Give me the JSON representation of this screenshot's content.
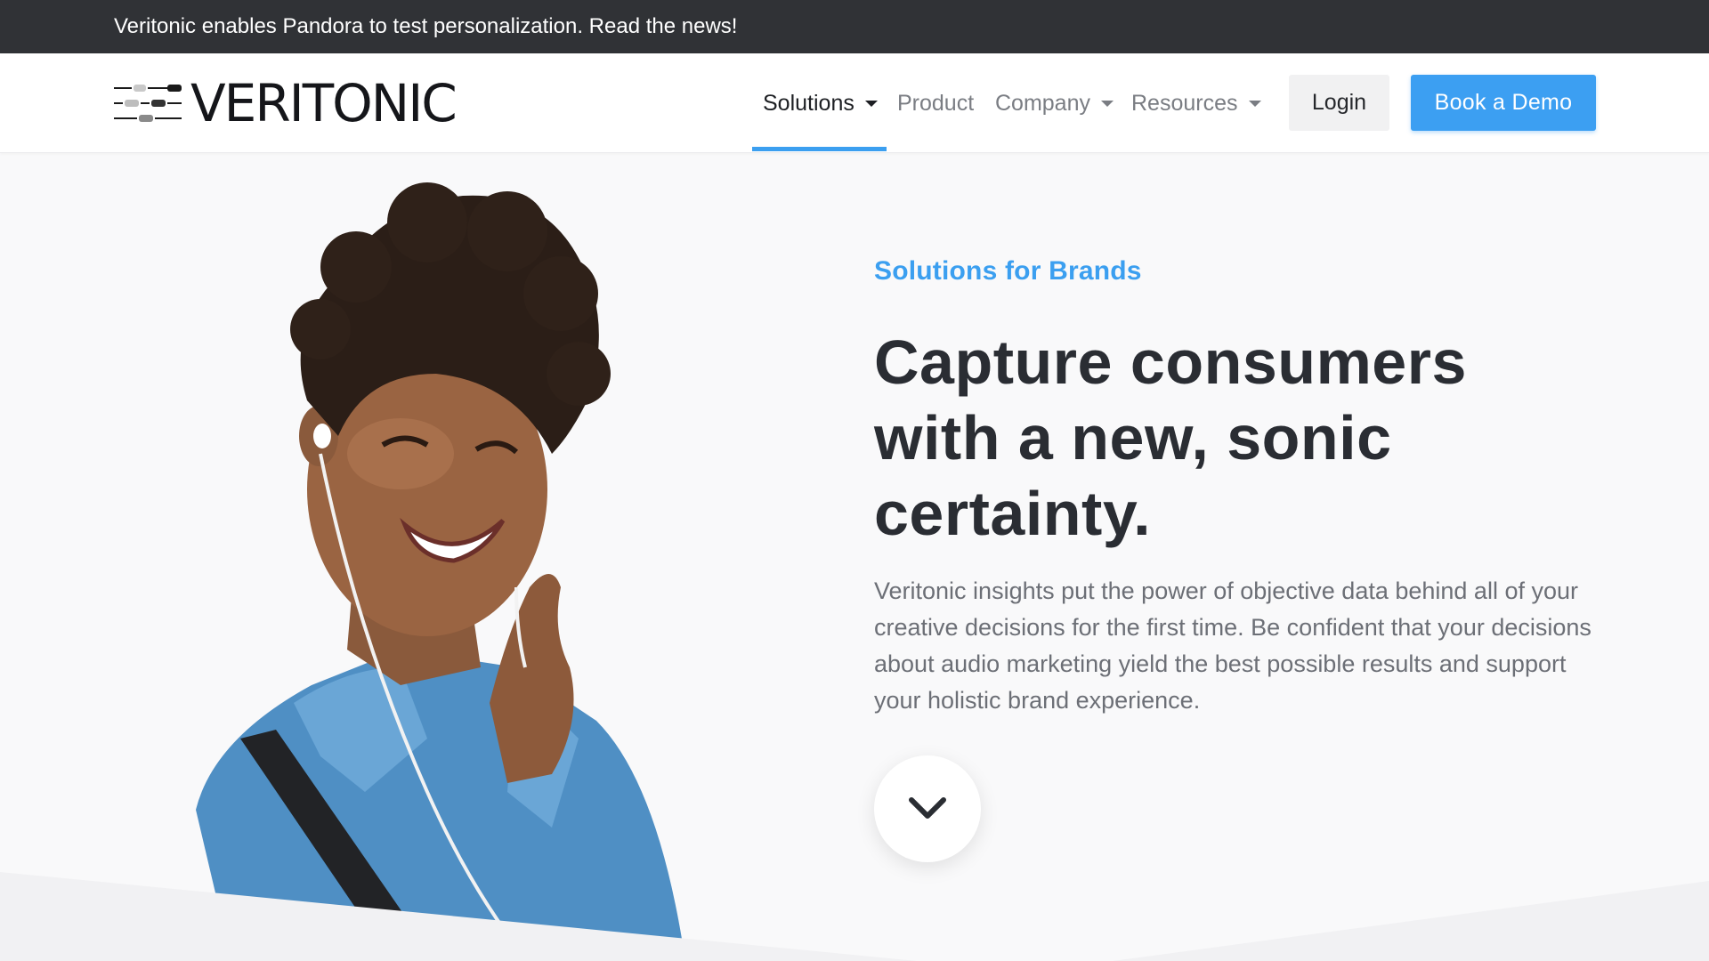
{
  "announcement": {
    "text": "Veritonic enables Pandora to test personalization. Read the news!"
  },
  "brand": {
    "name": "VERITONIC"
  },
  "nav": {
    "items": [
      {
        "label": "Solutions",
        "dropdown": true,
        "active": true
      },
      {
        "label": "Product",
        "dropdown": false,
        "active": false
      },
      {
        "label": "Company",
        "dropdown": true,
        "active": false
      },
      {
        "label": "Resources",
        "dropdown": true,
        "active": false
      }
    ],
    "login_label": "Login",
    "demo_label": "Book a Demo"
  },
  "hero": {
    "kicker": "Solutions for Brands",
    "headline": "Capture consumers with a new, sonic certainty.",
    "body": "Veritonic insights put the power of objective data behind all of your creative decisions for the first time. Be confident that your decisions about audio marketing yield the best possible results and support your holistic brand experience.",
    "scroll_icon": "chevron-down-icon",
    "image_subject": "smiling woman with curly hair wearing earbuds and a denim jacket"
  },
  "colors": {
    "accent": "#3c9ff2",
    "announcement_bg": "#303236",
    "heading": "#2a2d33",
    "body_text": "#6c6f76",
    "page_bg": "#f9f9fa"
  }
}
